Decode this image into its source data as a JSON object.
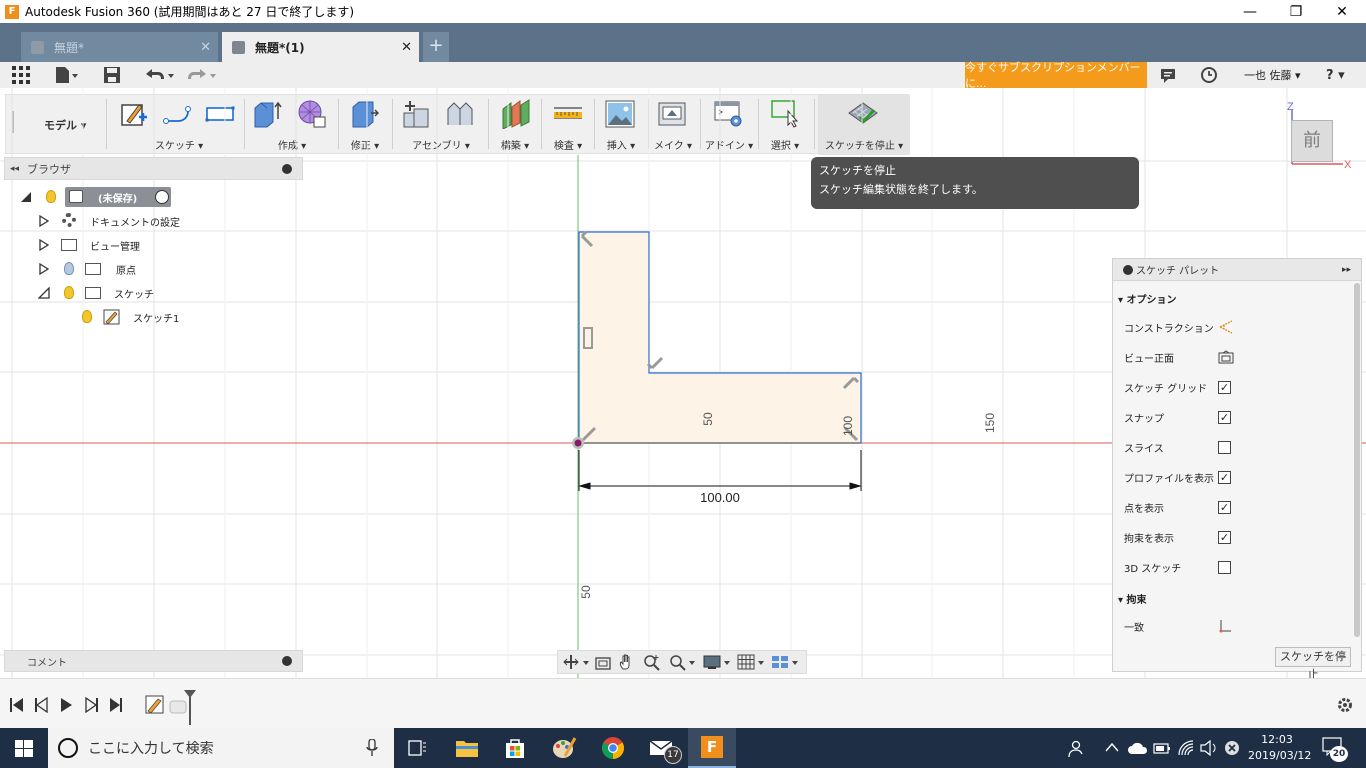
{
  "titlebar": {
    "title": "Autodesk Fusion 360 (試用期間はあと 27 日で終了します)",
    "app_letter": "F",
    "minimize": "—",
    "restore": "❐",
    "close": "✕"
  },
  "tabs": [
    {
      "label": "無題*",
      "close": "✕"
    },
    {
      "label": "無題*(1)",
      "close": "✕"
    }
  ],
  "new_tab": "+",
  "quick_access": {
    "subscribe": "今すぐサブスクリプションメンバーに...",
    "user": "一也 佐藤 ▾",
    "help": "? ▾"
  },
  "ribbon": {
    "mode": "モデル ▾",
    "groups": [
      {
        "label": "スケッチ ▾"
      },
      {
        "label": "作成 ▾"
      },
      {
        "label": "修正 ▾"
      },
      {
        "label": "アセンブリ ▾"
      },
      {
        "label": "構築 ▾"
      },
      {
        "label": "検査 ▾"
      },
      {
        "label": "挿入 ▾"
      },
      {
        "label": "メイク ▾"
      },
      {
        "label": "アドイン ▾"
      },
      {
        "label": "選択 ▾"
      },
      {
        "label": "スケッチを停止 ▾"
      }
    ]
  },
  "browser": {
    "title": "ブラウザ",
    "collapse": "◂◂",
    "items": [
      {
        "label": "(未保存)"
      },
      {
        "label": "ドキュメントの設定"
      },
      {
        "label": "ビュー管理"
      },
      {
        "label": "原点"
      },
      {
        "label": "スケッチ"
      },
      {
        "label": "スケッチ1"
      }
    ]
  },
  "tooltip": {
    "title": "スケッチを停止",
    "description": "スケッチ編集状態を終了します。"
  },
  "viewcube": {
    "face": "前",
    "z": "Z",
    "x": "X"
  },
  "canvas": {
    "dimension_width": "100.00",
    "dimension_50_inner": "50",
    "dimension_100_inner": "100",
    "ruler_150": "150",
    "ruler_50": "50"
  },
  "palette": {
    "title": "スケッチ パレット",
    "expand": "▸▸",
    "options_header": "▾ オプション",
    "rows": [
      {
        "label": "コンストラクション"
      },
      {
        "label": "ビュー正面"
      },
      {
        "label": "スケッチ グリッド",
        "checked": "✓"
      },
      {
        "label": "スナップ",
        "checked": "✓"
      },
      {
        "label": "スライス",
        "checked": ""
      },
      {
        "label": "プロファイルを表示",
        "checked": "✓"
      },
      {
        "label": "点を表示",
        "checked": "✓"
      },
      {
        "label": "拘束を表示",
        "checked": "✓"
      },
      {
        "label": "3D スケッチ",
        "checked": ""
      }
    ],
    "constraints_header": "▾ 拘束",
    "constraint_first": "一致",
    "stop_button": "スケッチを停止"
  },
  "comments": {
    "label": "コメント"
  },
  "taskbar": {
    "search_placeholder": "ここに入力して検索",
    "mail_badge": "17",
    "time": "12:03",
    "date": "2019/03/12",
    "notification_count": "20",
    "fusion_letter": "F"
  },
  "colors": {
    "tab_bar": "#5b7288",
    "subscribe": "#f59b1c",
    "profile_fill": "#fdf3e6",
    "sketch_line": "#2f6fd6",
    "axis_red": "#e05a5a",
    "axis_green": "#6abf69",
    "taskbar": "#1d2e45"
  }
}
